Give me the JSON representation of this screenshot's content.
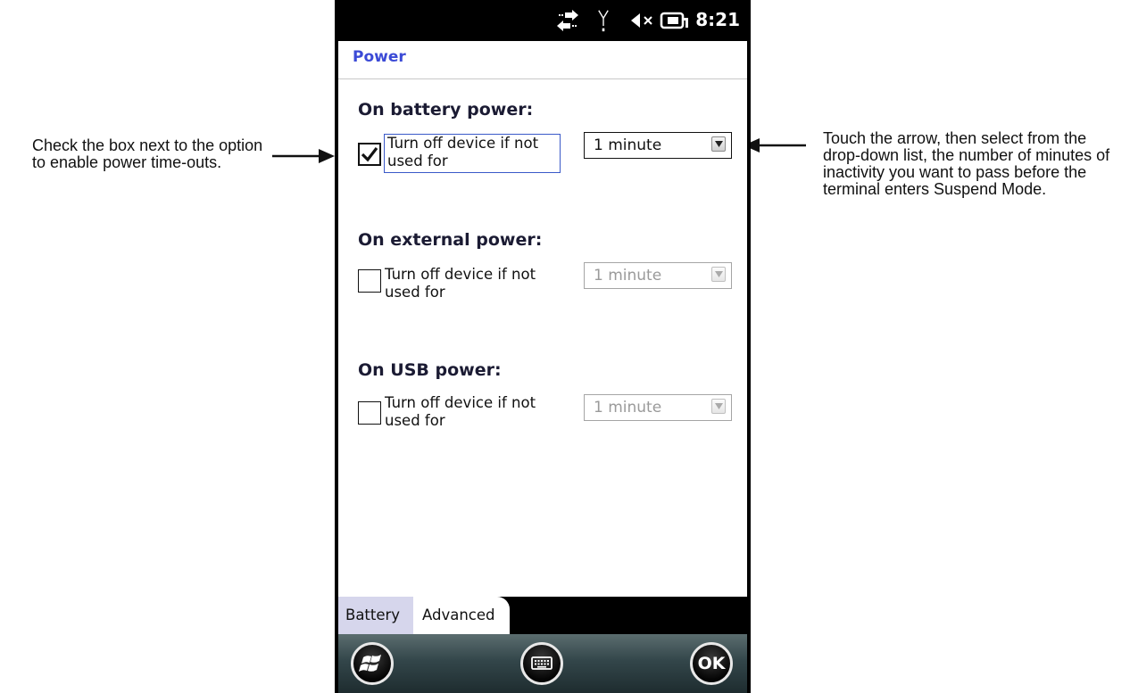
{
  "status_bar": {
    "time": "8:21"
  },
  "header": {
    "title": "Power"
  },
  "sections": [
    {
      "heading": "On battery power:",
      "checkbox_label": "Turn off device if not used for",
      "checked": true,
      "dropdown_value": "1 minute",
      "enabled": true
    },
    {
      "heading": "On external power:",
      "checkbox_label": "Turn off device if not used for",
      "checked": false,
      "dropdown_value": "1 minute",
      "enabled": false
    },
    {
      "heading": "On USB power:",
      "checkbox_label": "Turn off device if not used for",
      "checked": false,
      "dropdown_value": "1 minute",
      "enabled": false
    }
  ],
  "tabs": [
    {
      "label": "Battery",
      "selected": false
    },
    {
      "label": "Advanced",
      "selected": true
    }
  ],
  "bottom_bar": {
    "ok_label": "OK"
  },
  "annotations": {
    "left": "Check the box next to the option to enable power time-outs.",
    "right": "Touch the arrow, then select from the drop-down list, the number of minutes of inactivity you want to pass before the terminal enters Suspend Mode."
  },
  "icons": [
    "network-sync-icon",
    "signal-antenna-icon",
    "speaker-muted-icon",
    "battery-charging-icon",
    "windows-start-icon",
    "keyboard-icon"
  ],
  "colors": {
    "title": "#3b4ad6",
    "focus_border": "#3a59c8",
    "tab_inactive": "#d6d6ec"
  }
}
